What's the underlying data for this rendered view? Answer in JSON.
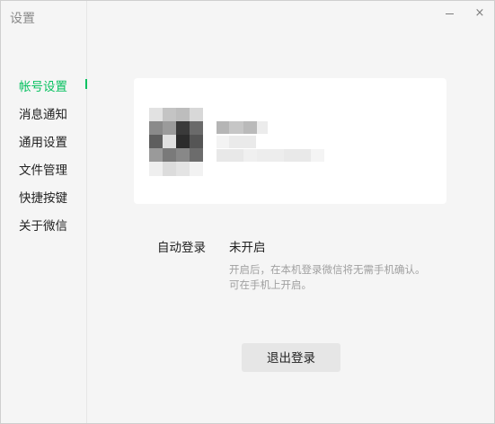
{
  "window": {
    "title": "设置",
    "minimize_icon": "minimize-icon",
    "close_glyph": "×",
    "close_icon": "close-icon"
  },
  "sidebar": {
    "active_color": "#07c160",
    "items": [
      {
        "label": "帐号设置",
        "active": true
      },
      {
        "label": "消息通知",
        "active": false
      },
      {
        "label": "通用设置",
        "active": false
      },
      {
        "label": "文件管理",
        "active": false
      },
      {
        "label": "快捷按键",
        "active": false
      },
      {
        "label": "关于微信",
        "active": false
      }
    ]
  },
  "account": {
    "avatar": "pixelated-avatar",
    "name": "",
    "wechat_id": ""
  },
  "auto_login": {
    "label": "自动登录",
    "value": "未开启",
    "hint_line1": "开启后，在本机登录微信将无需手机确认。",
    "hint_line2": "可在手机上开启。"
  },
  "logout": {
    "label": "退出登录"
  }
}
